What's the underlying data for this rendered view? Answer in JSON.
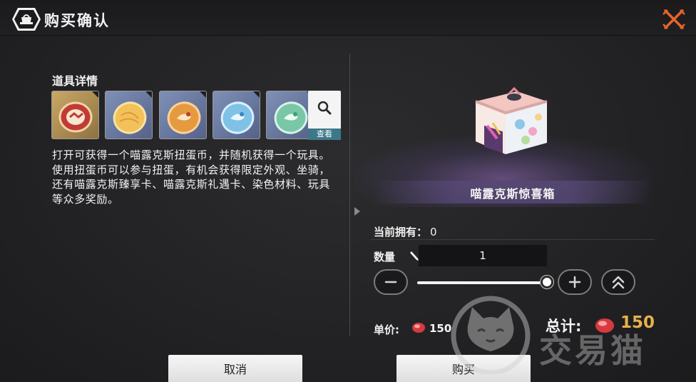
{
  "dialog": {
    "title": "购买确认",
    "title_icon": "shop-bag-icon",
    "close_icon": "close-x-icon"
  },
  "detail": {
    "section_title": "道具详情",
    "item_tiles": [
      {
        "icon": "gacha-coin-red-icon"
      },
      {
        "icon": "gacha-coin-yellow-icon"
      },
      {
        "icon": "gacha-coin-orange-icon"
      },
      {
        "icon": "gacha-coin-blue-icon"
      },
      {
        "icon": "gacha-coin-green-icon"
      }
    ],
    "search_label": "查看",
    "description": "打开可获得一个喵露克斯扭蛋币，并随机获得一个玩具。使用扭蛋币可以参与扭蛋，有机会获得限定外观、坐骑，还有喵露克斯臻享卡、喵露克斯礼遇卡、染色材料、玩具等众多奖励。"
  },
  "product": {
    "name": "喵露克斯惊喜箱",
    "image": "surprise-gift-box-image"
  },
  "purchase": {
    "owned_label": "当前拥有：",
    "owned_value": "0",
    "quantity_label": "数量",
    "quantity_value": "1",
    "slider_fraction": 1.0,
    "unit_price_label": "单价:",
    "unit_price": "150",
    "total_label": "总计:",
    "total_price": "150",
    "currency_icon": "red-gem-currency-icon"
  },
  "buttons": {
    "cancel": "取消",
    "buy": "购买"
  },
  "watermark": {
    "text": "交易猫",
    "icon": "cat-logo-icon"
  },
  "colors": {
    "accent_orange": "#e8632a",
    "price_gold": "#e7b14a",
    "search_label_bg": "#3d7888"
  }
}
